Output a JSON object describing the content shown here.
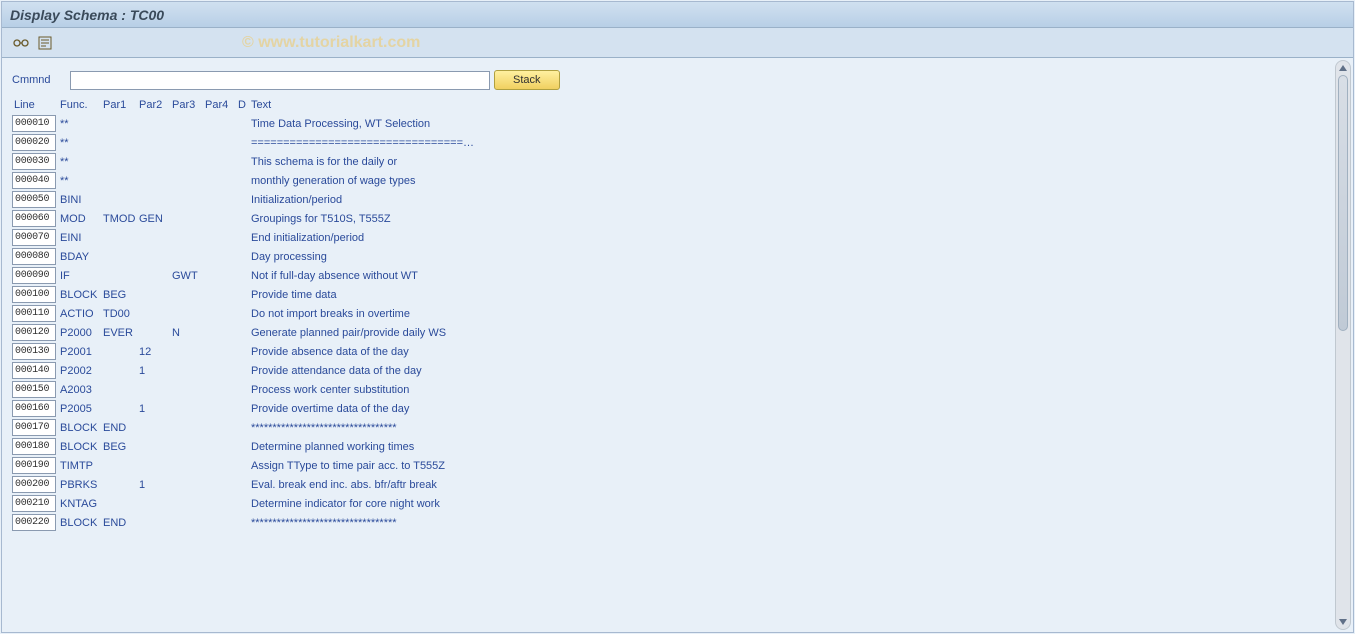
{
  "window": {
    "title": "Display Schema : TC00"
  },
  "watermark": "© www.tutorialkart.com",
  "toolbar": {
    "icon1": "glasses-icon",
    "icon2": "detail-icon"
  },
  "command": {
    "label": "Cmmnd",
    "value": "",
    "stack_label": "Stack"
  },
  "headers": {
    "line": "Line",
    "func": "Func.",
    "par1": "Par1",
    "par2": "Par2",
    "par3": "Par3",
    "par4": "Par4",
    "d": "D",
    "text": "Text"
  },
  "rows": [
    {
      "line": "000010",
      "func": "**",
      "par1": "",
      "par2": "",
      "par3": "",
      "par4": "",
      "d": "",
      "text": "Time Data Processing, WT Selection"
    },
    {
      "line": "000020",
      "func": "**",
      "par1": "",
      "par2": "",
      "par3": "",
      "par4": "",
      "d": "",
      "text": "=================================…"
    },
    {
      "line": "000030",
      "func": "**",
      "par1": "",
      "par2": "",
      "par3": "",
      "par4": "",
      "d": "",
      "text": "This schema is for the daily or"
    },
    {
      "line": "000040",
      "func": "**",
      "par1": "",
      "par2": "",
      "par3": "",
      "par4": "",
      "d": "",
      "text": "monthly generation of wage types"
    },
    {
      "line": "000050",
      "func": "BINI",
      "par1": "",
      "par2": "",
      "par3": "",
      "par4": "",
      "d": "",
      "text": "Initialization/period"
    },
    {
      "line": "000060",
      "func": "MOD",
      "par1": "TMOD",
      "par2": "GEN",
      "par3": "",
      "par4": "",
      "d": "",
      "text": "Groupings for T510S, T555Z"
    },
    {
      "line": "000070",
      "func": "EINI",
      "par1": "",
      "par2": "",
      "par3": "",
      "par4": "",
      "d": "",
      "text": "End initialization/period"
    },
    {
      "line": "000080",
      "func": "BDAY",
      "par1": "",
      "par2": "",
      "par3": "",
      "par4": "",
      "d": "",
      "text": "Day processing"
    },
    {
      "line": "000090",
      "func": "IF",
      "par1": "",
      "par2": "",
      "par3": "GWT",
      "par4": "",
      "d": "",
      "text": "Not if full-day absence without WT"
    },
    {
      "line": "000100",
      "func": "BLOCK",
      "par1": "BEG",
      "par2": "",
      "par3": "",
      "par4": "",
      "d": "",
      "text": "Provide time data"
    },
    {
      "line": "000110",
      "func": "ACTIO",
      "par1": "TD00",
      "par2": "",
      "par3": "",
      "par4": "",
      "d": "",
      "text": "Do not import breaks in overtime"
    },
    {
      "line": "000120",
      "func": "P2000",
      "par1": "EVER",
      "par2": "",
      "par3": "N",
      "par4": "",
      "d": "",
      "text": "Generate planned pair/provide daily WS"
    },
    {
      "line": "000130",
      "func": "P2001",
      "par1": "",
      "par2": "12",
      "par3": "",
      "par4": "",
      "d": "",
      "text": "Provide absence data of the day"
    },
    {
      "line": "000140",
      "func": "P2002",
      "par1": "",
      "par2": "1",
      "par3": "",
      "par4": "",
      "d": "",
      "text": "Provide attendance data of the day"
    },
    {
      "line": "000150",
      "func": "A2003",
      "par1": "",
      "par2": "",
      "par3": "",
      "par4": "",
      "d": "",
      "text": "Process work center substitution"
    },
    {
      "line": "000160",
      "func": "P2005",
      "par1": "",
      "par2": "1",
      "par3": "",
      "par4": "",
      "d": "",
      "text": "Provide overtime data of the day"
    },
    {
      "line": "000170",
      "func": "BLOCK",
      "par1": "END",
      "par2": "",
      "par3": "",
      "par4": "",
      "d": "",
      "text": "**********************************"
    },
    {
      "line": "000180",
      "func": "BLOCK",
      "par1": "BEG",
      "par2": "",
      "par3": "",
      "par4": "",
      "d": "",
      "text": "Determine planned working times"
    },
    {
      "line": "000190",
      "func": "TIMTP",
      "par1": "",
      "par2": "",
      "par3": "",
      "par4": "",
      "d": "",
      "text": "Assign TType to time pair acc. to T555Z"
    },
    {
      "line": "000200",
      "func": "PBRKS",
      "par1": "",
      "par2": "1",
      "par3": "",
      "par4": "",
      "d": "",
      "text": "Eval. break end inc. abs. bfr/aftr break"
    },
    {
      "line": "000210",
      "func": "KNTAG",
      "par1": "",
      "par2": "",
      "par3": "",
      "par4": "",
      "d": "",
      "text": "Determine indicator for core night work"
    },
    {
      "line": "000220",
      "func": "BLOCK",
      "par1": "END",
      "par2": "",
      "par3": "",
      "par4": "",
      "d": "",
      "text": "**********************************"
    }
  ]
}
